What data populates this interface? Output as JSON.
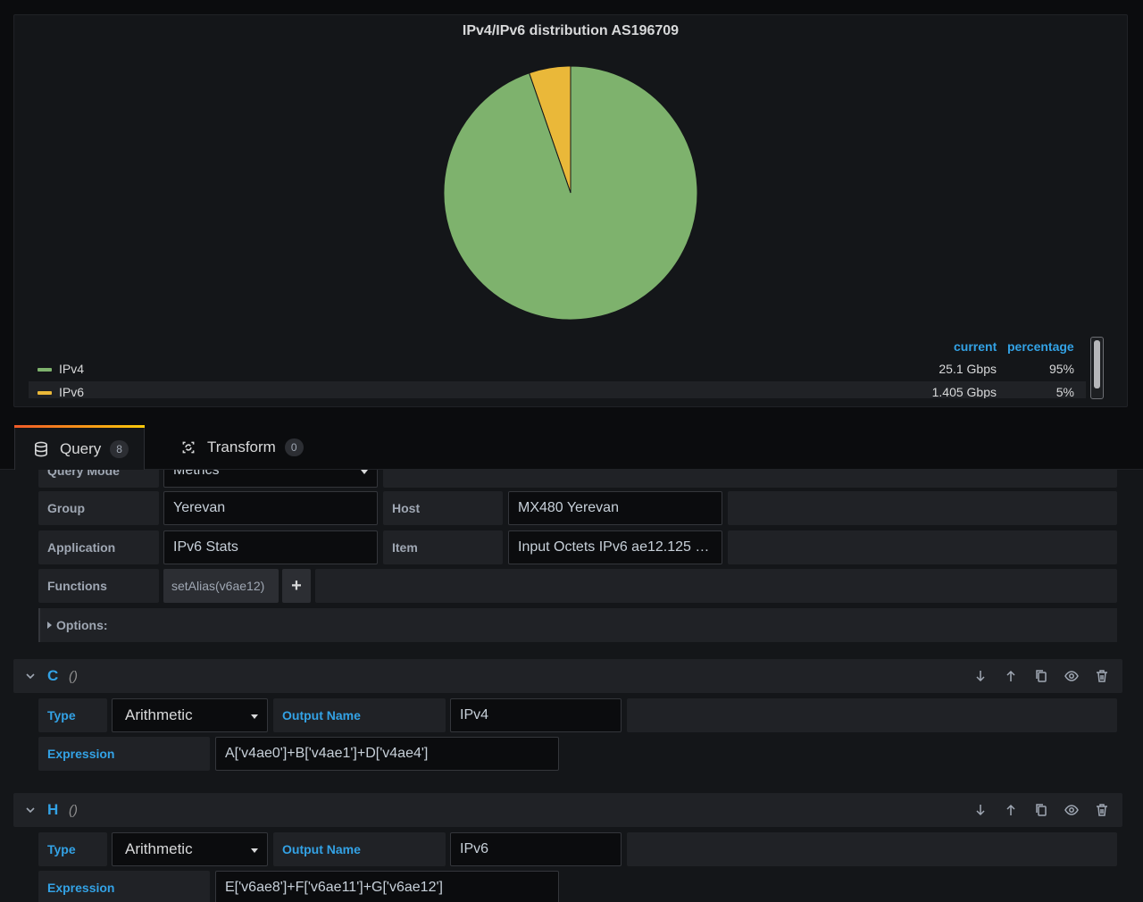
{
  "panel": {
    "title": "IPv4/IPv6 distribution AS196709",
    "legend": {
      "col_current": "current",
      "col_percentage": "percentage",
      "rows": [
        {
          "name": "IPv4",
          "current": "25.1 Gbps",
          "percentage": "95%",
          "color": "#7eb26d"
        },
        {
          "name": "IPv6",
          "current": "1.405 Gbps",
          "percentage": "5%",
          "color": "#eab839"
        }
      ]
    }
  },
  "chart_data": {
    "type": "pie",
    "categories": [
      "IPv4",
      "IPv6"
    ],
    "values": [
      25.1,
      1.405
    ],
    "colors": [
      "#7eb26d",
      "#eab839"
    ],
    "title": "IPv4/IPv6 distribution AS196709",
    "legend": "bottom"
  },
  "tabs": [
    {
      "label": "Query",
      "count": "8",
      "icon": "database-icon"
    },
    {
      "label": "Transform",
      "count": "0",
      "icon": "transform-icon"
    }
  ],
  "query_b": {
    "query_mode_label": "Query Mode",
    "query_mode_value": "Metrics",
    "group_label": "Group",
    "group_value": "Yerevan",
    "host_label": "Host",
    "host_value": "MX480  Yerevan",
    "application_label": "Application",
    "application_value": "IPv6 Stats",
    "item_label": "Item",
    "item_value": "Input Octets IPv6 ae12.125 …",
    "functions_label": "Functions",
    "function_chip": "setAlias(v6ae12)",
    "add_symbol": "+",
    "options_label": "Options:"
  },
  "query_c": {
    "id": "C",
    "paren": "()",
    "type_label": "Type",
    "type_value": "Arithmetic",
    "output_label": "Output Name",
    "output_value": "IPv4",
    "expression_label": "Expression",
    "expression_value": "A['v4ae0']+B['v4ae1']+D['v4ae4']"
  },
  "query_h": {
    "id": "H",
    "paren": "()",
    "type_label": "Type",
    "type_value": "Arithmetic",
    "output_label": "Output Name",
    "output_value": "IPv6",
    "expression_label": "Expression",
    "expression_value": "E['v6ae8']+F['v6ae11']+G['v6ae12']"
  },
  "colors": {
    "accent_blue": "#33a2e5",
    "panel_bg": "#141619",
    "tab_gradient_start": "#f05a28",
    "tab_gradient_end": "#fbca0a"
  }
}
